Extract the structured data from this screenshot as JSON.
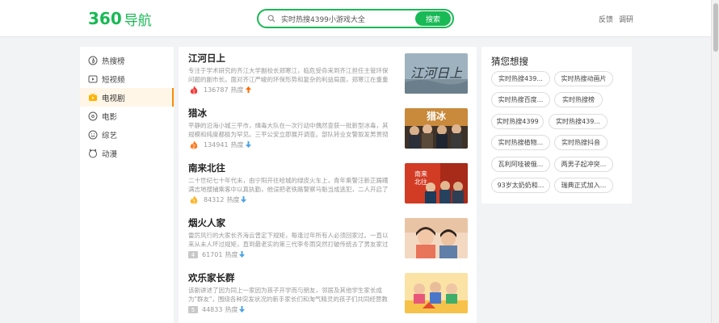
{
  "header": {
    "logo_num": "360",
    "logo_text": "导航",
    "search": {
      "value": "实时热搜4399小游戏大全",
      "button_label": "搜索"
    },
    "links": [
      "反馈",
      "调研"
    ]
  },
  "leftnav": {
    "items": [
      {
        "label": "热搜榜",
        "icon": "hot-search-icon",
        "active": false
      },
      {
        "label": "短视频",
        "icon": "short-video-icon",
        "active": false
      },
      {
        "label": "电视剧",
        "icon": "tv-icon",
        "active": true
      },
      {
        "label": "电影",
        "icon": "movie-icon",
        "active": false
      },
      {
        "label": "综艺",
        "icon": "variety-icon",
        "active": false
      },
      {
        "label": "动漫",
        "icon": "anime-icon",
        "active": false
      }
    ]
  },
  "list": {
    "heat_label": "热度",
    "items": [
      {
        "rank": "1",
        "title": "江河日上",
        "desc": "专注于学术研究的齐江大学副校长郑寒江，临危受命来到齐江担任主管环保问题的副市长。面对齐江严峻的环保形势和复杂的利益局面，郑寒江在重重阻力中坚持...",
        "heat": "136787",
        "trend": "up"
      },
      {
        "rank": "2",
        "title": "猎冰",
        "desc": "平静的沿海小城三平市，缉毒大队在一次行动中偶然查获一批新型冰毒，其规模和纯度都极为罕见。三平公安立即展开调查。部队转业女警叙发男贯彻缉毒的决心...",
        "heat": "134941",
        "trend": "down"
      },
      {
        "rank": "3",
        "title": "南来北往",
        "desc": "二十世纪七十年代末，由宁阳开往哈城的绿皮火车上，青年乘警汪新正踌躇满志地搜捕乘客中以真执勤，他误把老铁路警察马魁当成逃犯，二人开启了不打不相...",
        "heat": "84312",
        "trend": "down"
      },
      {
        "rank": "4",
        "title": "烟火人家",
        "desc": "雷厉风行的大家长齐海云曾定下规矩，每逢过年所有人必须回家过。一直以来从未人坏过规矩，直到最老实的第三代李冬雨突然打破传统去了男友家过年。家...",
        "heat": "61701",
        "trend": "down"
      },
      {
        "rank": "5",
        "title": "欢乐家长群",
        "desc": "该剧讲述了因为同上一家因为孩子开学而与朋友，邻居及其他学生家长成为\"群友\"，围绕各种突发状况的新手家长们和淘气精灵的孩子们共同经营教育新课堂，人生新...",
        "heat": "44833",
        "trend": "down"
      }
    ]
  },
  "rightpanel": {
    "title": "猜您想搜",
    "tags": [
      "实时热搜439...",
      "实时热搜动画片",
      "实时热搜百度...",
      "实时热搜榜",
      "实时热搜4399",
      "实时热搜439...",
      "实时热搜植物...",
      "实时热搜抖音",
      "瓦利阿哇被俄...",
      "两男子起冲突...",
      "93岁太奶奶和...",
      "瑞典正式加入..."
    ]
  },
  "colors": {
    "brand_green": "#19b955",
    "active_orange": "#ff8a00",
    "trend_up": "#ff6a00",
    "trend_down": "#4aa3e6"
  }
}
